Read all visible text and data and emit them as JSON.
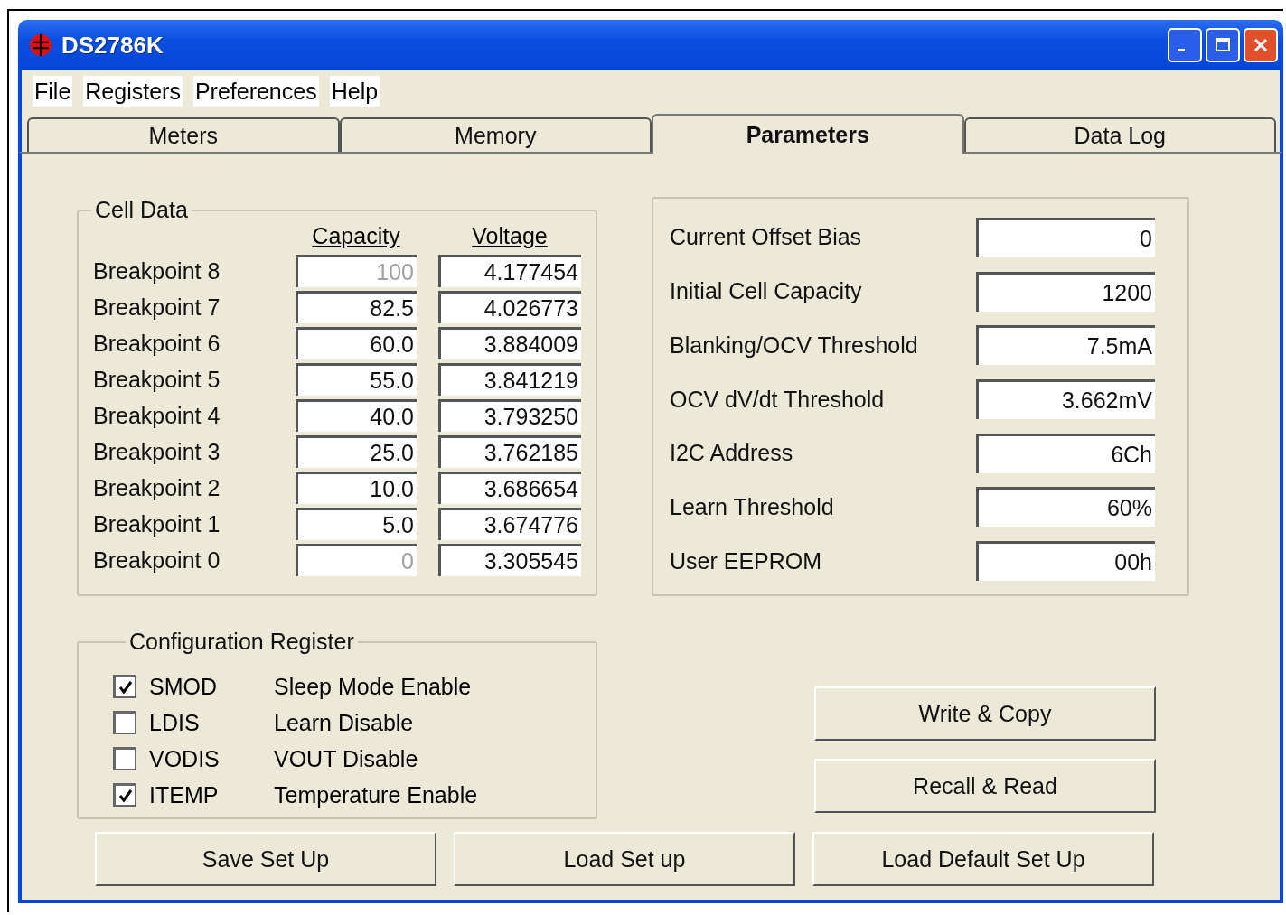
{
  "window": {
    "title": "DS2786K"
  },
  "menu": [
    "File",
    "Registers",
    "Preferences",
    "Help"
  ],
  "tabs": [
    {
      "label": "Meters",
      "selected": false
    },
    {
      "label": "Memory",
      "selected": false
    },
    {
      "label": "Parameters",
      "selected": true
    },
    {
      "label": "Data Log",
      "selected": false
    }
  ],
  "cell_data": {
    "title": "Cell Data",
    "columns": [
      "Capacity",
      "Voltage"
    ],
    "rows": [
      {
        "label": "Breakpoint 8",
        "capacity": "100",
        "capacity_disabled": true,
        "voltage": "4.177454"
      },
      {
        "label": "Breakpoint 7",
        "capacity": "82.5",
        "capacity_disabled": false,
        "voltage": "4.026773"
      },
      {
        "label": "Breakpoint 6",
        "capacity": "60.0",
        "capacity_disabled": false,
        "voltage": "3.884009"
      },
      {
        "label": "Breakpoint 5",
        "capacity": "55.0",
        "capacity_disabled": false,
        "voltage": "3.841219"
      },
      {
        "label": "Breakpoint 4",
        "capacity": "40.0",
        "capacity_disabled": false,
        "voltage": "3.793250"
      },
      {
        "label": "Breakpoint 3",
        "capacity": "25.0",
        "capacity_disabled": false,
        "voltage": "3.762185"
      },
      {
        "label": "Breakpoint 2",
        "capacity": "10.0",
        "capacity_disabled": false,
        "voltage": "3.686654"
      },
      {
        "label": "Breakpoint 1",
        "capacity": "5.0",
        "capacity_disabled": false,
        "voltage": "3.674776"
      },
      {
        "label": "Breakpoint 0",
        "capacity": "0",
        "capacity_disabled": true,
        "voltage": "3.305545"
      }
    ]
  },
  "parameters": [
    {
      "label": "Current Offset Bias",
      "value": "0"
    },
    {
      "label": "Initial Cell Capacity",
      "value": "1200"
    },
    {
      "label": "Blanking/OCV Threshold",
      "value": "7.5mA"
    },
    {
      "label": "OCV dV/dt Threshold",
      "value": "3.662mV"
    },
    {
      "label": "I2C Address",
      "value": "6Ch"
    },
    {
      "label": "Learn Threshold",
      "value": "60%"
    },
    {
      "label": "User EEPROM",
      "value": "00h"
    }
  ],
  "configuration_register": {
    "title": "Configuration Register",
    "bits": [
      {
        "name": "SMOD",
        "description": "Sleep Mode Enable",
        "checked": true
      },
      {
        "name": "LDIS",
        "description": "Learn Disable",
        "checked": false
      },
      {
        "name": "VODIS",
        "description": "VOUT Disable",
        "checked": false
      },
      {
        "name": "ITEMP",
        "description": "Temperature Enable",
        "checked": true
      }
    ]
  },
  "side_buttons": [
    "Write & Copy",
    "Recall & Read"
  ],
  "bottom_buttons": [
    "Save Set Up",
    "Load Set up",
    "Load Default Set Up"
  ]
}
